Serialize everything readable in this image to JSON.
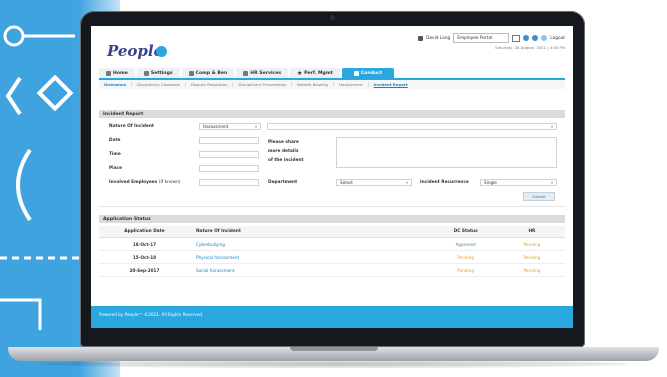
{
  "header": {
    "logo_text": "People",
    "user_name": "David Long",
    "role_select": "Employee Portal",
    "logout_label": "Logout",
    "datetime": "Saturday, 28 August, 2021 | 4:30 PM"
  },
  "nav": {
    "items": [
      {
        "label": "Home",
        "icon": "home-icon"
      },
      {
        "label": "Settings",
        "icon": "settings-icon"
      },
      {
        "label": "Comp & Ben",
        "icon": "comp-icon"
      },
      {
        "label": "HR Services",
        "icon": "hr-services-icon"
      },
      {
        "label": "Perf. Mgmt",
        "icon": "star-icon"
      },
      {
        "label": "Conduct",
        "icon": "conduct-icon",
        "active": true
      }
    ]
  },
  "subtabs": [
    "Grievance",
    "Disciplinary Casebook",
    "Dispute Resolution",
    "Disciplinary Proceedings",
    "Whistle Blowing",
    "Harassment",
    "Incident Report"
  ],
  "incident_panel": {
    "title": "Incident Report",
    "nature_label": "Nature Of Incident",
    "nature_value": "Harassment",
    "date_label": "Date",
    "time_label": "Time",
    "place_label": "Place",
    "details_label_1": "Please share",
    "details_label_2": "more details",
    "details_label_3": "of the incident",
    "involved_label": "Involved Employees",
    "involved_hint": "(If known)",
    "department_label": "Department",
    "department_value": "Select",
    "recurrence_label": "Incident Recurrence",
    "recurrence_value": "Single",
    "submit_label": "Submit"
  },
  "status_panel": {
    "title": "Application Status",
    "columns": [
      "Application Date",
      "Nature Of Incident",
      "DC Status",
      "HR"
    ],
    "rows": [
      {
        "date": "18-Oct-17",
        "nature": "Cyberbullying",
        "dc": "Approved",
        "hr": "Pending"
      },
      {
        "date": "15-Oct-18",
        "nature": "Physical harassment",
        "dc": "Pending",
        "hr": "Pending"
      },
      {
        "date": "20-Sep-2017",
        "nature": "Social harassment",
        "dc": "Pending",
        "hr": "Pending"
      }
    ]
  },
  "footer": {
    "text": "Powered by People™ ©2021. All Rights Reserved"
  },
  "colors": {
    "accent": "#2aa7df",
    "approved": "#3e9a3e",
    "pending": "#e0a030"
  }
}
